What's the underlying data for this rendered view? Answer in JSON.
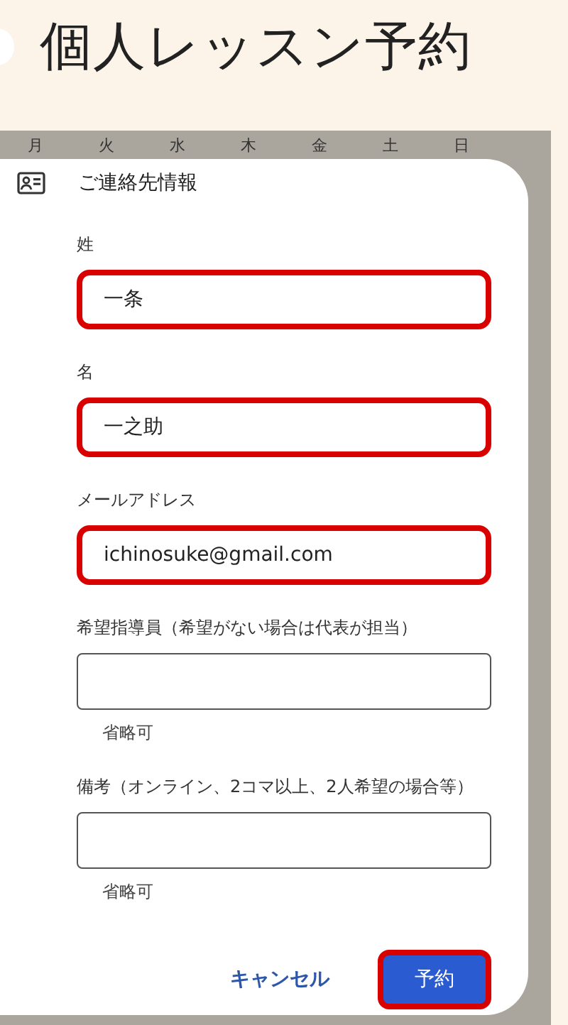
{
  "title": "個人レッスン予約",
  "weekdays": [
    "月",
    "火",
    "水",
    "木",
    "金",
    "土",
    "日"
  ],
  "section_title": "ご連絡先情報",
  "fields": [
    {
      "label": "姓",
      "value": "一条",
      "highlighted": true
    },
    {
      "label": "名",
      "value": "一之助",
      "highlighted": true
    },
    {
      "label": "メールアドレス",
      "value": "ichinosuke@gmail.com",
      "highlighted": true
    },
    {
      "label": "希望指導員（希望がない場合は代表が担当）",
      "highlighted": false,
      "hint": "省略可"
    },
    {
      "label": "備考（オンライン、2コマ以上、2人希望の場合等）",
      "highlighted": false,
      "hint": "省略可"
    }
  ],
  "buttons": [
    {
      "label": "キャンセル",
      "kind": "text",
      "highlighted": false
    },
    {
      "label": "予約",
      "kind": "primary",
      "highlighted": true
    }
  ]
}
